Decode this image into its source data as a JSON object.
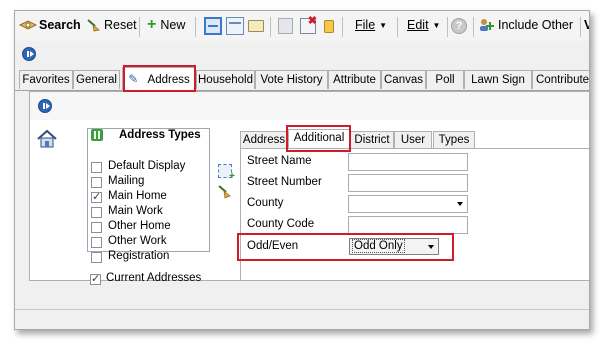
{
  "toolbar": {
    "search_label": "Search",
    "reset_label": "Reset",
    "new_label": "New",
    "file_label": "File",
    "edit_label": "Edit",
    "include_other_label": "Include Other",
    "overflow_label": "V"
  },
  "main_tabs": [
    {
      "label": "Favorites"
    },
    {
      "label": "General"
    },
    {
      "label": "Address",
      "active": true
    },
    {
      "label": "Household"
    },
    {
      "label": "Vote History"
    },
    {
      "label": "Attribute"
    },
    {
      "label": "Canvas"
    },
    {
      "label": "Poll"
    },
    {
      "label": "Lawn Sign"
    },
    {
      "label": "Contribute"
    }
  ],
  "address_types": {
    "title": "Address Types",
    "items": [
      {
        "label": "Default Display",
        "checked": false
      },
      {
        "label": "Mailing",
        "checked": false
      },
      {
        "label": "Main Home",
        "checked": true
      },
      {
        "label": "Main Work",
        "checked": false
      },
      {
        "label": "Other Home",
        "checked": false
      },
      {
        "label": "Other Work",
        "checked": false
      },
      {
        "label": "Registration",
        "checked": false
      }
    ],
    "current_addresses_label": "Current Addresses",
    "current_addresses_checked": true
  },
  "sub_tabs": [
    {
      "label": "Address"
    },
    {
      "label": "Additional",
      "active": true
    },
    {
      "label": "District"
    },
    {
      "label": "User"
    },
    {
      "label": "Types"
    }
  ],
  "fields": {
    "street_name": {
      "label": "Street Name",
      "value": ""
    },
    "street_number": {
      "label": "Street Number",
      "value": ""
    },
    "county": {
      "label": "County",
      "value": ""
    },
    "county_code": {
      "label": "County Code",
      "value": ""
    },
    "odd_even": {
      "label": "Odd/Even",
      "value": "Odd Only"
    }
  },
  "colors": {
    "highlight_red": "#d11a2a",
    "accent_blue": "#2f66b6",
    "green_badge": "#3aa13a"
  }
}
